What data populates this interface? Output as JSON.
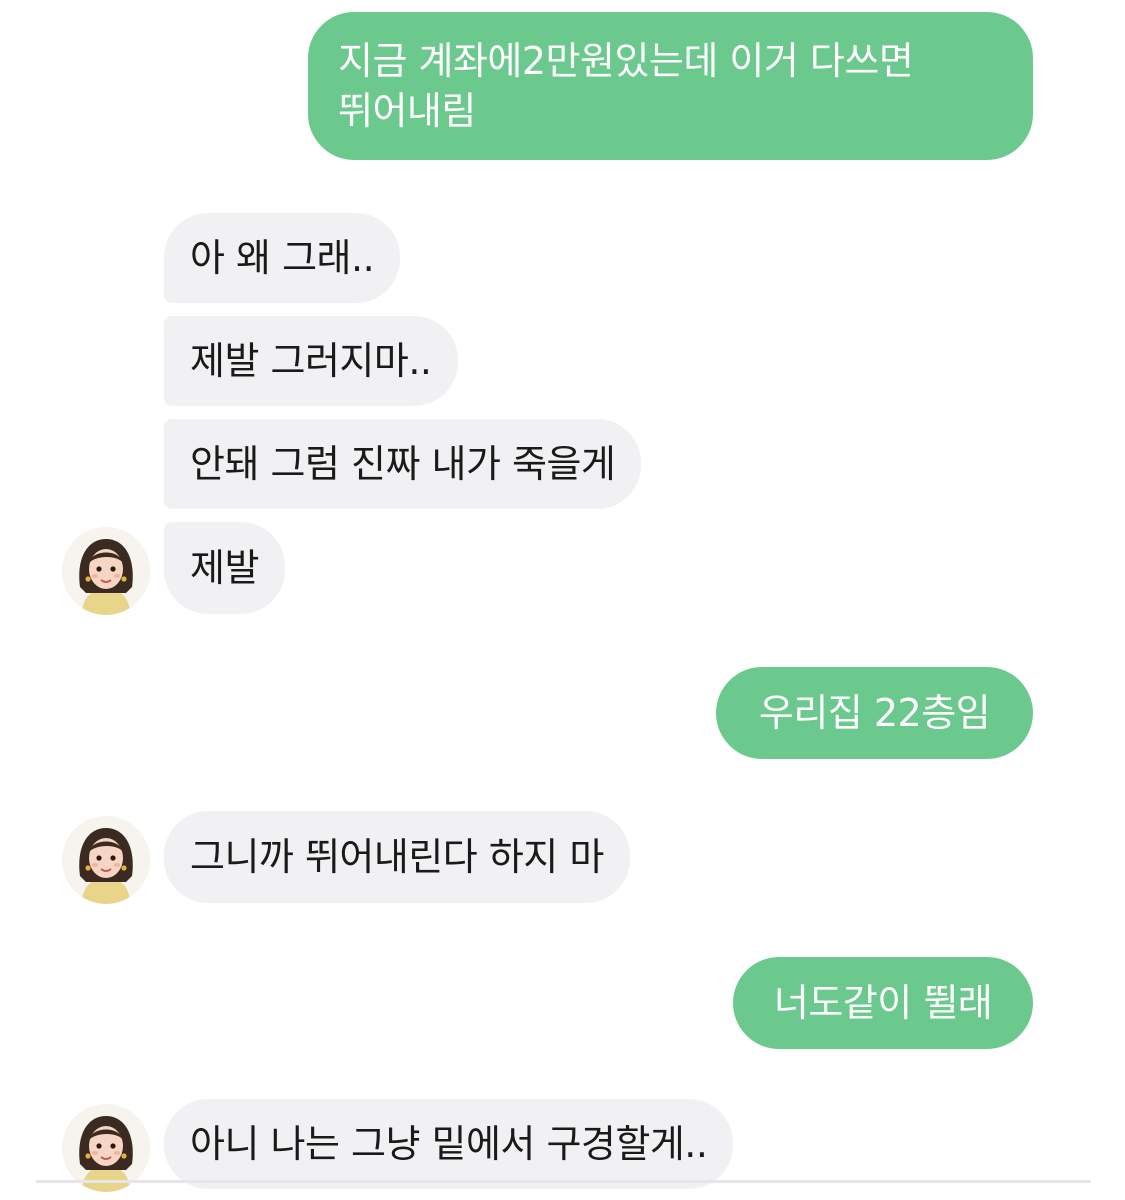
{
  "conversation": {
    "messages": [
      {
        "side": "sent",
        "lines": [
          "지금 계좌에2만원있는데 이거 다쓰면",
          "뛰어내림"
        ]
      },
      {
        "side": "received",
        "text": "아 왜 그래.."
      },
      {
        "side": "received",
        "text": "제발 그러지마.."
      },
      {
        "side": "received",
        "text": "안돼 그럼 진짜 내가 죽을게"
      },
      {
        "side": "received",
        "text": "제발"
      },
      {
        "side": "sent",
        "text": "우리집 22층임"
      },
      {
        "side": "received",
        "text": "그니까 뛰어내린다 하지 마"
      },
      {
        "side": "sent",
        "text": "너도같이 뛸래"
      },
      {
        "side": "received",
        "text": "아니 나는 그냥 밑에서 구경할게.."
      }
    ]
  },
  "colors": {
    "sent_bubble": "#6cc98e",
    "received_bubble": "#f1f1f3",
    "sent_text": "#ffffff",
    "received_text": "#1a1a1a"
  },
  "icons": {
    "avatar": "girl-portrait-avatar-icon"
  }
}
